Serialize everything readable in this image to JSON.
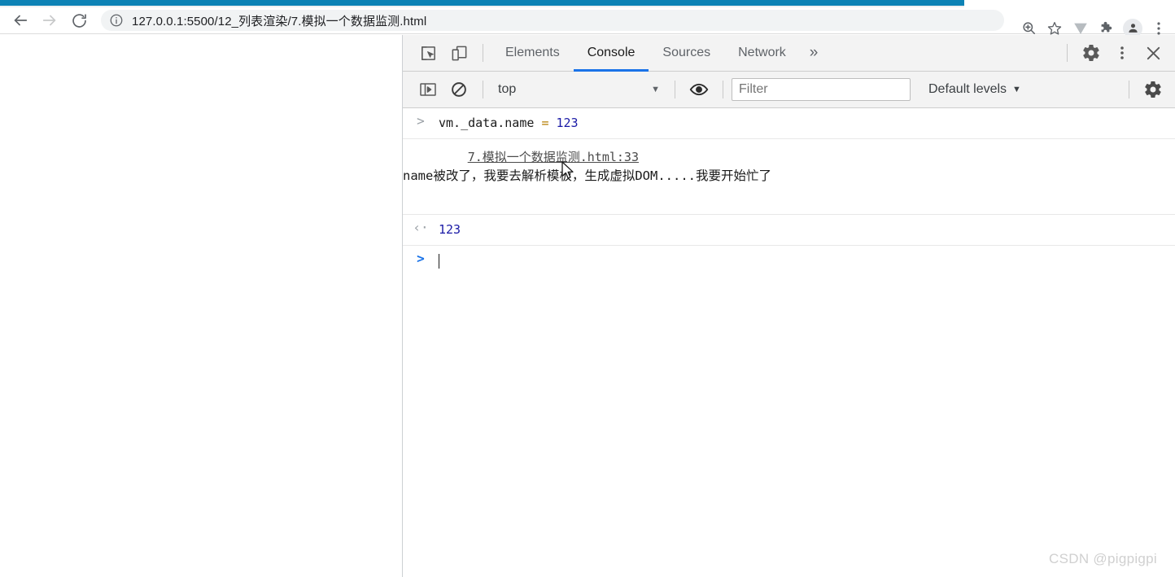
{
  "browser": {
    "nav": {
      "back_label": "Back",
      "forward_label": "Forward",
      "reload_label": "Reload"
    },
    "address": {
      "url": "127.0.0.1:5500/12_列表渲染/7.模拟一个数据监测.html",
      "site_info_icon": "info-circle-icon"
    },
    "toolbar_icons": [
      {
        "name": "zoom-icon",
        "glyph": "zoom"
      },
      {
        "name": "bookmark-star-icon",
        "glyph": "star"
      },
      {
        "name": "extension-v-icon",
        "glyph": "v"
      },
      {
        "name": "extensions-puzzle-icon",
        "glyph": "puzzle"
      },
      {
        "name": "profile-avatar-icon",
        "glyph": "person"
      },
      {
        "name": "chrome-menu-icon",
        "glyph": "kebab"
      }
    ],
    "accent_color": "#0d82b5"
  },
  "devtools": {
    "left_icons": [
      {
        "name": "inspect-element-icon"
      },
      {
        "name": "device-toolbar-icon"
      }
    ],
    "tabs": [
      {
        "label": "Elements",
        "active": false
      },
      {
        "label": "Console",
        "active": true
      },
      {
        "label": "Sources",
        "active": false
      },
      {
        "label": "Network",
        "active": false
      }
    ],
    "more_tabs_label": "»",
    "right_icons": [
      {
        "name": "settings-gear-icon"
      },
      {
        "name": "devtools-menu-icon"
      },
      {
        "name": "close-devtools-icon"
      }
    ],
    "active_tab_underline_color": "#1a73e8",
    "filterbar": {
      "sidebar_toggle_icon": "console-sidebar-icon",
      "clear_console_icon": "clear-console-icon",
      "context_selected": "top",
      "context_caret": "▼",
      "eye_icon": "live-expression-eye-icon",
      "filter_placeholder": "Filter",
      "filter_value": "",
      "levels_label": "Default levels",
      "levels_caret": "▼",
      "settings_icon": "console-settings-gear-icon"
    },
    "console": {
      "rows": [
        {
          "type": "command",
          "gutter": ">",
          "segments": [
            {
              "text": "vm._data.name ",
              "cls": "tok-plain"
            },
            {
              "text": "= ",
              "cls": "tok-op"
            },
            {
              "text": "123",
              "cls": "tok-num"
            }
          ]
        },
        {
          "type": "log",
          "gutter": "",
          "message": "name被改了，我要去解析模板，生成虚拟DOM.....我要开始忙了",
          "source": "7.模拟一个数据监测.html:33"
        },
        {
          "type": "result",
          "gutter": "‹·",
          "value": "123"
        },
        {
          "type": "prompt",
          "gutter": ">",
          "value": ""
        }
      ]
    }
  },
  "watermark": "CSDN @pigpigpi"
}
